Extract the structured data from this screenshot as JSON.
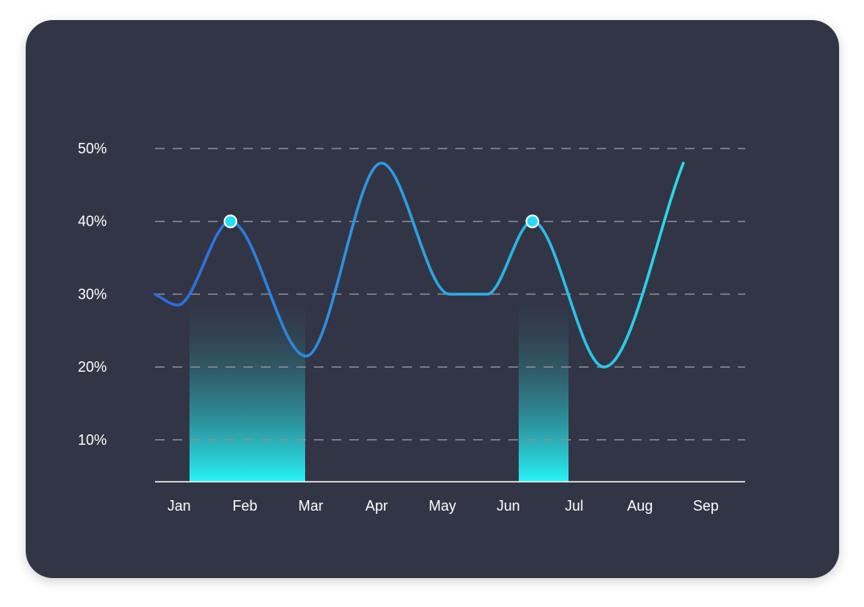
{
  "chart_data": {
    "type": "line",
    "title": "",
    "xlabel": "",
    "ylabel": "",
    "categories": [
      "Jan",
      "Feb",
      "Mar",
      "Apr",
      "May",
      "Jun",
      "Jul",
      "Aug",
      "Sep"
    ],
    "y_ticks": [
      "10%",
      "20%",
      "30%",
      "40%",
      "50%"
    ],
    "ylim": [
      4,
      50
    ],
    "grid": true,
    "series": [
      {
        "x": [
          0.0,
          0.3,
          1.0,
          2.0,
          3.0,
          3.9,
          4.4,
          5.0,
          5.95,
          7.0
        ],
        "values": [
          30,
          28.5,
          40,
          21.5,
          48,
          30,
          30,
          40,
          20,
          48
        ],
        "highlight_points": [
          {
            "x": 1.0,
            "value": 40,
            "category": "Feb"
          },
          {
            "x": 5.0,
            "value": 40,
            "category": "Jul"
          }
        ]
      }
    ],
    "highlight_bands": [
      {
        "from": "Jan",
        "to": "Mar"
      },
      {
        "from": "Jun",
        "to": "Jul"
      }
    ],
    "colors": {
      "card_background": "#323545",
      "line_start": "#2a6bdc",
      "line_end": "#2ae6ef",
      "band_top": "#323545",
      "band_bottom": "#27f3f7",
      "grid": "#8a8c98",
      "axis": "#ffffff",
      "marker_fill": "#27dcfb",
      "text": "#ffffff"
    }
  }
}
